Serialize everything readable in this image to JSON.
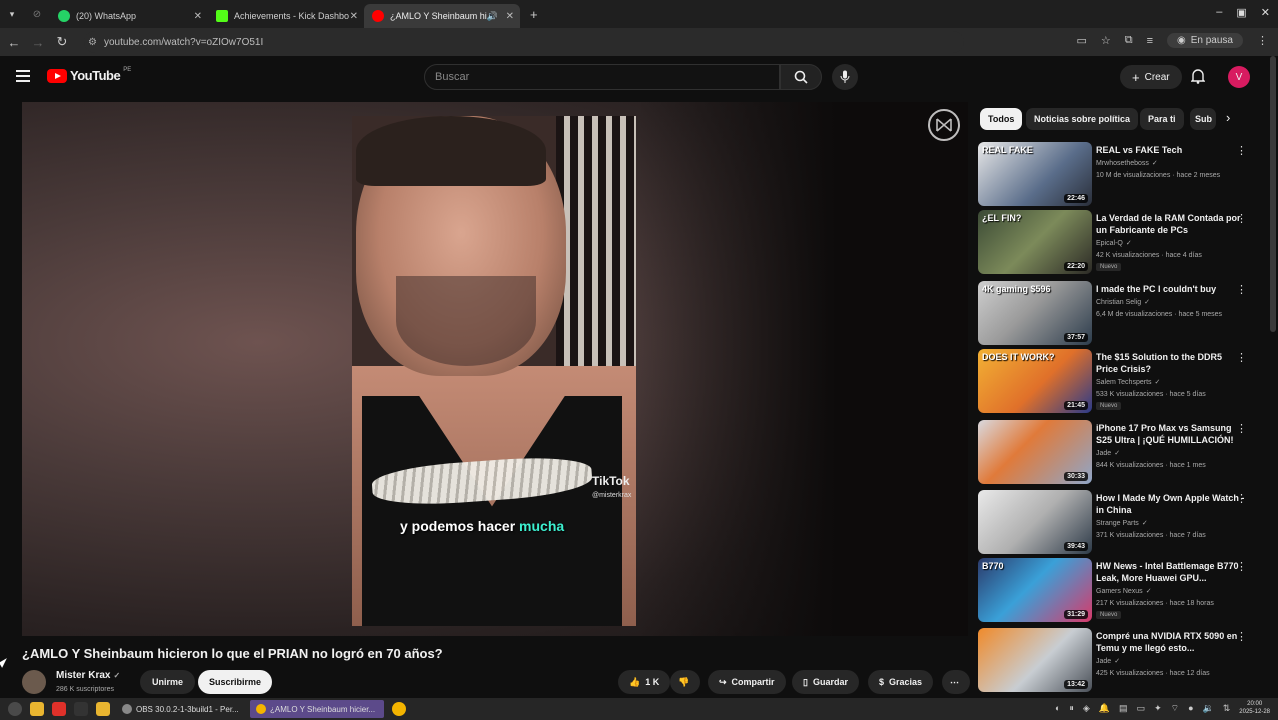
{
  "browser": {
    "tabs": [
      {
        "label": "(20) WhatsApp",
        "color": "#25d366",
        "icon": "whatsapp-icon"
      },
      {
        "label": "Achievements - Kick Dashbo",
        "color": "#53fc18",
        "icon": "kick-icon"
      },
      {
        "label": "¿AMLO Y Sheinbaum hi",
        "color": "#ff0000",
        "icon": "youtube-icon"
      }
    ],
    "url": "youtube.com/watch?v=oZIOw7O51I",
    "profile_status": "En pausa"
  },
  "header": {
    "logo_text": "YouTube",
    "logo_region": "PE",
    "search_placeholder": "Buscar",
    "create_label": "Crear",
    "avatar_letter": "V"
  },
  "player": {
    "subtitle_part1": "y podemos hacer ",
    "subtitle_highlight": "mucha",
    "tiktok_label": "TikTok",
    "tiktok_user": "@misterkrax"
  },
  "video": {
    "title": "¿AMLO Y Sheinbaum hicieron lo que el PRIAN no logró en 70 años?",
    "channel": "Mister Krax",
    "subscribers": "286 K suscriptores",
    "join_label": "Unirme",
    "subscribe_label": "Suscribirme",
    "likes": "1 K",
    "share_label": "Compartir",
    "save_label": "Guardar",
    "thanks_label": "Gracias"
  },
  "chips": [
    "Todos",
    "Noticias sobre política",
    "Para ti",
    "Sub"
  ],
  "recommended": [
    {
      "title": "REAL vs FAKE Tech",
      "channel": "Mrwhosetheboss",
      "meta": "10 M de visualizaciones · hace 2 meses",
      "duration": "22:46",
      "thumb_text": "REAL   FAKE",
      "nuevo": "",
      "bg": "linear-gradient(135deg,#e8e8e8,#5a6d8a 60%,#2a2f3a)"
    },
    {
      "title": "La Verdad de la RAM Contada por un Fabricante de PCs",
      "channel": "Epical-Q",
      "meta": "42 K visualizaciones · hace 4 días",
      "duration": "22:20",
      "thumb_text": "¿EL FIN?",
      "nuevo": "Nuevo",
      "bg": "linear-gradient(135deg,#3b4a35,#7c8a5a 50%,#2c2a26)"
    },
    {
      "title": "I made the PC I couldn't buy",
      "channel": "Christian Selig",
      "meta": "6,4 M de visualizaciones · hace 5 meses",
      "duration": "37:57",
      "thumb_text": "4K gaming  $596",
      "nuevo": "",
      "bg": "linear-gradient(135deg,#cfcfcf,#9a9a9a 45%,#2c3c4c)"
    },
    {
      "title": "The $15 Solution to the DDR5 Price Crisis?",
      "channel": "Salem Techsperts",
      "meta": "533 K visualizaciones · hace 5 días",
      "duration": "21:45",
      "thumb_text": "DOES IT WORK?",
      "nuevo": "Nuevo",
      "bg": "linear-gradient(135deg,#f2b134,#e0702a 55%,#2a3a8a)"
    },
    {
      "title": "iPhone 17 Pro Max vs Samsung S25 Ultra | ¡QUÉ HUMILLACIÓN!",
      "channel": "Jade",
      "meta": "844 K visualizaciones · hace 1 mes",
      "duration": "30:33",
      "thumb_text": "",
      "nuevo": "",
      "bg": "linear-gradient(135deg,#d9d9df,#e07a3a 40%,#8fa6c8)"
    },
    {
      "title": "How I Made My Own Apple Watch - in China",
      "channel": "Strange Parts",
      "meta": "371 K visualizaciones · hace 7 días",
      "duration": "39:43",
      "thumb_text": "",
      "nuevo": "",
      "bg": "linear-gradient(135deg,#e9e9e9,#b0b0b0 50%,#2d3a48)"
    },
    {
      "title": "HW News - Intel Battlemage B770 Leak, More Huawei GPU...",
      "channel": "Gamers Nexus",
      "meta": "217 K visualizaciones · hace 18 horas",
      "duration": "31:29",
      "thumb_text": "B770",
      "nuevo": "Nuevo",
      "bg": "linear-gradient(135deg,#2b3a6a,#3aa0d8 45%,#d83a6a)"
    },
    {
      "title": "Compré una NVIDIA RTX 5090 en Temu y me llegó esto...",
      "channel": "Jade",
      "meta": "425 K visualizaciones · hace 12 días",
      "duration": "13:42",
      "thumb_text": "",
      "nuevo": "",
      "bg": "linear-gradient(135deg,#f08a2a,#c8cdd2 55%,#4a5058)"
    }
  ],
  "taskbar": {
    "tasks": [
      "OBS 30.0.2-1-3build1 - Per...",
      "¿AMLO Y Sheinbaum hicier..."
    ],
    "time": "20:00",
    "date": "2025-12-28"
  },
  "colors": {
    "accent": "#ff0000",
    "bg": "#0f0f0f",
    "highlight_text": "#3df0d0"
  }
}
